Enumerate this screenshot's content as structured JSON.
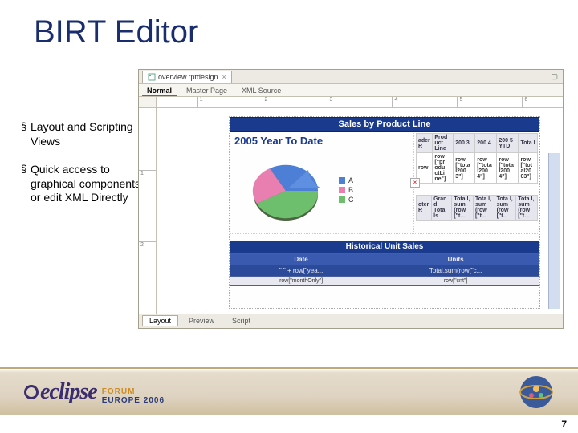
{
  "slide": {
    "title": "BIRT Editor",
    "page_number": "7"
  },
  "bullets": [
    "Layout and Scripting Views",
    "Quick access to graphical components or edit XML Directly"
  ],
  "editor": {
    "file_tab": "overview.rptdesign",
    "mode_tabs": [
      "Normal",
      "Master Page",
      "XML Source"
    ],
    "active_mode": 0,
    "bottom_tabs": [
      "Layout",
      "Preview",
      "Script"
    ],
    "active_bottom": 0,
    "ruler_ticks": [
      "1",
      "2",
      "3",
      "4",
      "5",
      "6"
    ],
    "vruler_ticks": [
      "1",
      "2"
    ]
  },
  "report": {
    "header": "Sales by Product Line",
    "chart_title": "2005 Year To Date",
    "legend": [
      "A",
      "B",
      "C"
    ],
    "legend_colors": [
      "#4e7fd6",
      "#e97fb0",
      "#6dbf6d"
    ]
  },
  "chart_data": {
    "type": "pie",
    "title": "2005 Year To Date",
    "series": [
      {
        "name": "A",
        "value": 25,
        "color": "#4e7fd6"
      },
      {
        "name": "B",
        "value": 20,
        "color": "#e97fb0"
      },
      {
        "name": "C",
        "value": 55,
        "color": "#6dbf6d"
      }
    ]
  },
  "bind_grid": {
    "top_header_left": "ader R",
    "top_headers": [
      "Prod uct Line",
      "200 3",
      "200 4",
      "200 5 YTD",
      "Tota l"
    ],
    "row_cells": [
      "row [\"pr odu ctLi ne\"]",
      "row [\"tota l200 3\"]",
      "row [\"tota l200 4\"]",
      "row [\"tot al20 03\"]"
    ],
    "row_extra": "row",
    "footer_left": "oter R",
    "footer_cells_top": [
      "Gran d Tota ls",
      "Tota l, sum (row [\"t...",
      "Tota l, sum (row [\"t...",
      "Tota l, sum (row [\"t...",
      "Tota l, sum (row [\"t..."
    ]
  },
  "lower": {
    "title": "Historical Unit Sales",
    "headers": [
      "Date",
      "Units"
    ],
    "row1": [
      "\" \" + row[\"yea...",
      "Total.sum(row[\"c..."
    ],
    "row2": [
      "row[\"monthOnly\"]",
      "row[\"cnt\"]"
    ]
  },
  "footer": {
    "brand": "eclipse",
    "forum": "FORUM",
    "region": "EUROPE 2006"
  }
}
